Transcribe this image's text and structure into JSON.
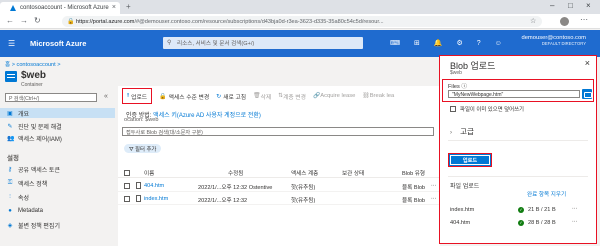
{
  "browser": {
    "tab_title": "contosoaccount - Microsoft Azure",
    "url_host": "https://portal.azure.com",
    "url_path": "/#@demouser.contoso.com/resource/subscriptions/d43bja0d-r3ea-3623-d335-35a80c54c5d/resour..."
  },
  "azure": {
    "brand": "Microsoft Azure",
    "search_placeholder": "리소스, 서비스 및 문서 검색(G+/)",
    "user_email": "demouser@contoso.com",
    "user_directory": "DEFAULT DIRECTORY"
  },
  "blade": {
    "breadcrumb": "홈 > contosoaccount >",
    "title": "$web",
    "subtitle": "Container"
  },
  "sidenav": {
    "search_placeholder": "P 검색(Ctrl+/)",
    "collapse": "«",
    "items": [
      {
        "label": "개요",
        "icon": "▣",
        "selected": true
      },
      {
        "label": "진단 및 문제 해결",
        "icon": "✎",
        "selected": false
      },
      {
        "label": "액세스 제어(IAM)",
        "icon": "👥",
        "selected": false
      }
    ],
    "settings_header": "설정",
    "settings_items": [
      {
        "label": "공유 액세스 토큰",
        "icon": "⚷"
      },
      {
        "label": "액세스 정책",
        "icon": "⚿"
      },
      {
        "label": "속성",
        "icon": "⫶"
      },
      {
        "label": "Metadata",
        "icon": "●"
      },
      {
        "label": "불변 정책 편집기",
        "icon": "◈"
      }
    ]
  },
  "toolbar": {
    "upload": "업로드",
    "change_access": "액세스 수준 변경",
    "refresh": "새로 고침",
    "delete": "삭제",
    "change_tier": "계층 변경",
    "acquire_lease": "Acquire lease",
    "break_lease": "Break lea"
  },
  "main": {
    "auth_label": "인증 방법: ",
    "auth_value": "액세스 키(Azure AD 사용자 계정으로 전환)",
    "location_label": "ocation: $web",
    "blob_search_placeholder": "접두사로 Blob 검색(대/소문자 구분)",
    "filter_label": "필터 추가",
    "columns": [
      "이름",
      "수정됨",
      "액세스 계층",
      "보관 상태",
      "Blob 유형"
    ],
    "rows": [
      {
        "name": "404.htm",
        "modified": "2022/1/...오후 12:32 Ostentive",
        "tier": "핫(유추됨)",
        "archive": "",
        "type": "블록 Blob"
      },
      {
        "name": "index.htm",
        "modified": "2022/1/...오후 12:32",
        "tier": "핫(유추됨)",
        "archive": "",
        "type": "블록 Blob"
      }
    ]
  },
  "upload_panel": {
    "title": "Blob 업로드",
    "subtitle": "$web",
    "files_label": "Files ⓘ",
    "files_value": "\"MyNewWebpage.htm\"",
    "overwrite_label": "파일이 이미 있으면 덮어쓰기",
    "advanced_label": "고급",
    "upload_button": "업로드",
    "uploads_header": "파일 업로드",
    "clear_link": "완료 항목 지우기",
    "items": [
      {
        "name": "index.htm",
        "size": "21 B / 21 B"
      },
      {
        "name": "404.htm",
        "size": "28 B / 28 B"
      }
    ],
    "status_color": "#107c10"
  },
  "colors": {
    "azure_header": "#1f6bcf",
    "accent": "#0078d4",
    "highlight_box": "#e81123"
  }
}
